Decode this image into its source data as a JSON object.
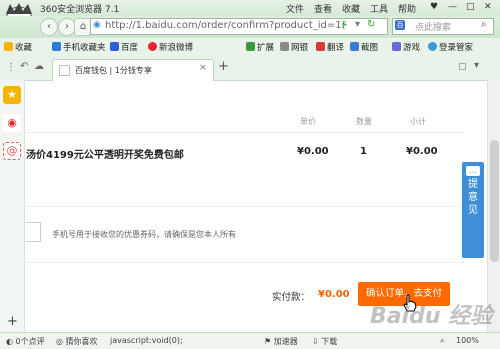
{
  "window": {
    "title": "360安全浏览器 7.1",
    "menu": [
      "文件",
      "查看",
      "收藏",
      "工具",
      "帮助"
    ]
  },
  "nav": {
    "url": "http://1.baidu.com/order/confirm?product_id=1(",
    "search_placeholder": "点此搜索"
  },
  "bookmarks": {
    "left": [
      {
        "label": "收藏",
        "icon": "star-icon"
      },
      {
        "label": "手机收藏夹",
        "icon": "phone-icon"
      },
      {
        "label": "百度",
        "icon": "baidu-icon"
      },
      {
        "label": "新浪微博",
        "icon": "weibo-icon"
      }
    ],
    "right": [
      {
        "label": "扩展",
        "icon": "puzzle-icon"
      },
      {
        "label": "网银",
        "icon": "bank-icon"
      },
      {
        "label": "翻译",
        "icon": "translate-icon"
      },
      {
        "label": "截图",
        "icon": "scissors-icon"
      },
      {
        "label": "游戏",
        "icon": "game-icon"
      },
      {
        "label": "登录管家",
        "icon": "user-icon"
      }
    ]
  },
  "tab": {
    "label": "百度钱包 | 1分钱专享",
    "new_tab": "+"
  },
  "table": {
    "headers": [
      "单价",
      "数量",
      "小计"
    ],
    "product_name": "汤价4199元公平透明开奖免费包邮",
    "unit_price": "¥0.00",
    "quantity": "1",
    "subtotal": "¥0.00"
  },
  "coupon_note": "手机号用于接收您的优惠券码，请确保是您本人所有",
  "payment": {
    "label": "实付款：",
    "amount": "¥0.00",
    "confirm_button": "确认订单，去支付"
  },
  "feedback": {
    "label_line1": "提",
    "label_line2": "意",
    "label_line3": "见"
  },
  "status": {
    "points": "0个点评",
    "guess": "猜你喜欢",
    "link": "javascript:void(0);",
    "speed": "加速器",
    "download": "下载",
    "zoom": "100%"
  },
  "watermark": "Baidu 经验"
}
